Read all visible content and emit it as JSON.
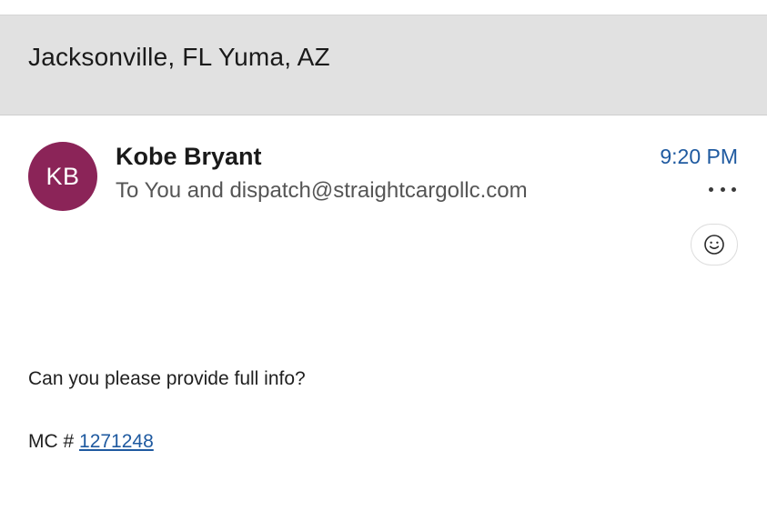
{
  "header": {
    "subject": "Jacksonville, FL Yuma, AZ"
  },
  "message": {
    "avatar_initials": "KB",
    "avatar_color": "#8b2458",
    "sender_name": "Kobe Bryant",
    "recipients": "To You and dispatch@straightcargollc.com",
    "time": "9:20 PM",
    "accent_color": "#1f5aa0",
    "more_icon": "more-horizontal-icon",
    "reaction_icon": "smiley-face-icon"
  },
  "body": {
    "line1": "Can you please provide full info?",
    "mc_prefix": "MC # ",
    "mc_number": "1271248"
  }
}
